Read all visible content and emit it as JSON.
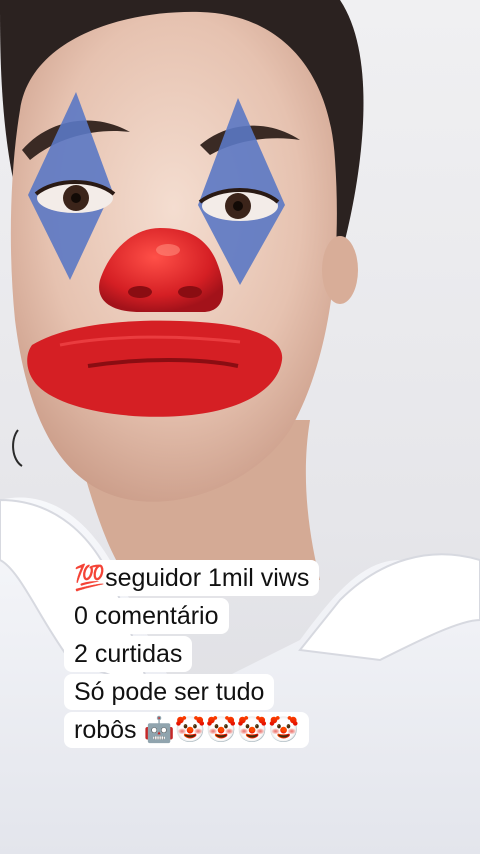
{
  "caption": {
    "lines": [
      "💯seguidor 1mil viws",
      "0 comentário",
      "2 curtidas",
      "Só pode ser tudo",
      "robôs 🤖🤡🤡🤡🤡"
    ]
  },
  "colors": {
    "background": "#e9e9ec",
    "skin": "#e8c8b6",
    "hair": "#2b2220",
    "eye_paint": "#5b78c4",
    "clown_red": "#d51f24",
    "shirt": "#f2f3f7",
    "caption_bg": "#ffffff",
    "caption_text": "#111111"
  },
  "subject": {
    "description_icon": "clown-makeup-face"
  }
}
